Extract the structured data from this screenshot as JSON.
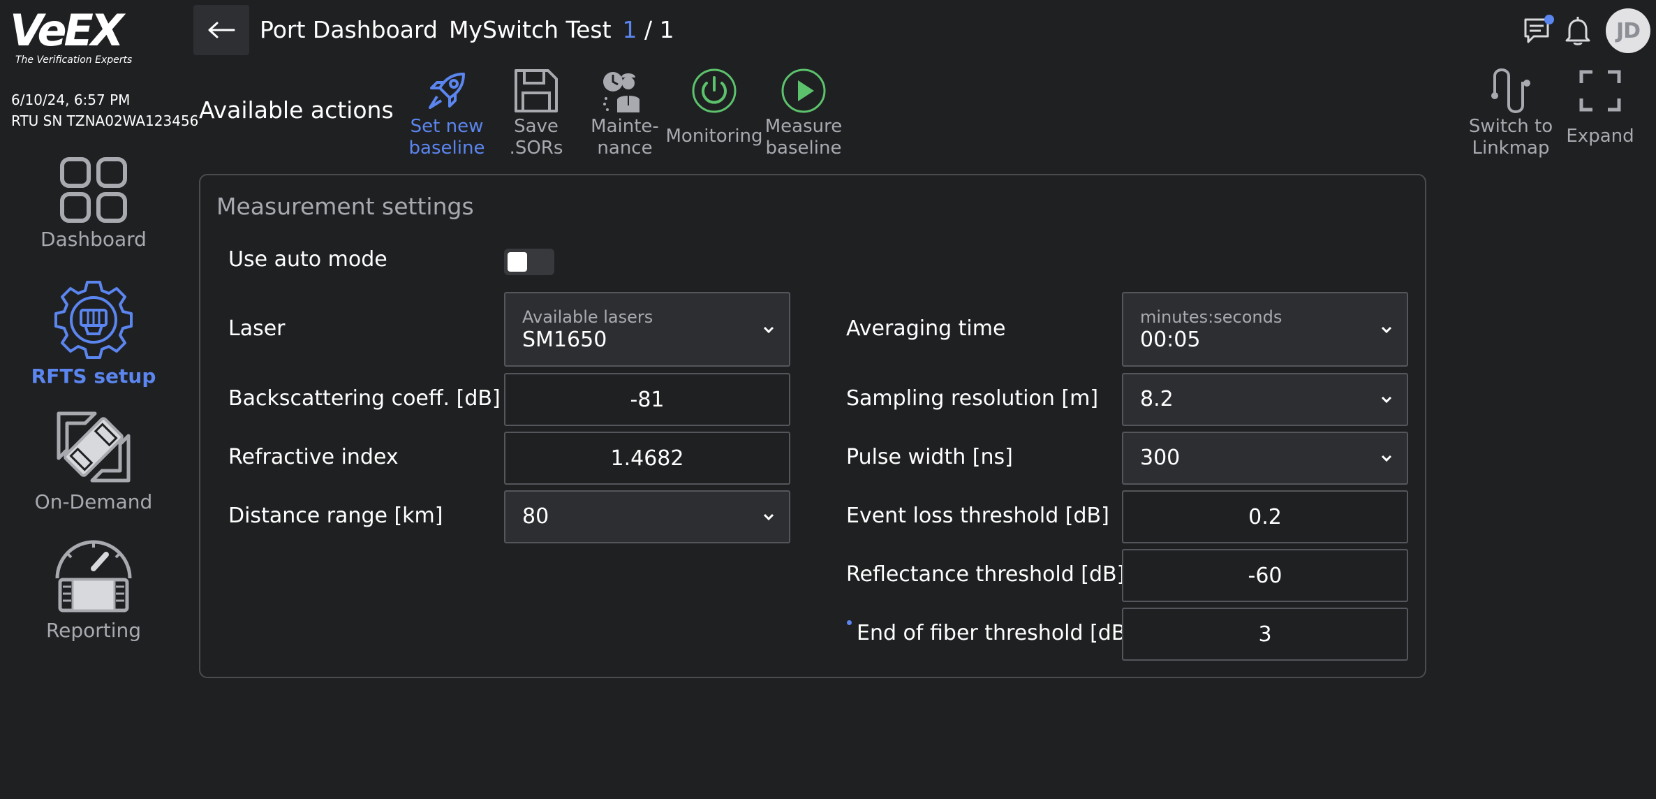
{
  "brand": {
    "logo_text": "VeEX",
    "tagline": "The Verification Experts"
  },
  "device": {
    "datetime": "6/10/24, 6:57 PM",
    "serial": "RTU SN TZNA02WA123456"
  },
  "header": {
    "title": "Port Dashboard",
    "subtitle": "MySwitch Test",
    "page_current": "1",
    "page_separator": "/ 1",
    "avatar_initials": "JD"
  },
  "sidebar": {
    "items": [
      {
        "label": "Dashboard",
        "icon": "grid-icon",
        "active": false
      },
      {
        "label": "RFTS setup",
        "icon": "gear-icon",
        "active": true
      },
      {
        "label": "On-Demand",
        "icon": "ondemand-icon",
        "active": false
      },
      {
        "label": "Reporting",
        "icon": "gauge-icon",
        "active": false
      }
    ]
  },
  "actions": {
    "title": "Available actions",
    "items": [
      {
        "line1": "Set new",
        "line2": "baseline",
        "icon": "rocket-icon",
        "active": true
      },
      {
        "line1": "Save",
        "line2": ".SORs",
        "icon": "save-icon",
        "active": false
      },
      {
        "line1": "Mainte-",
        "line2": "nance",
        "icon": "maintenance-icon",
        "active": false
      },
      {
        "line1": "Monitoring",
        "line2": "",
        "icon": "power-icon",
        "active": false
      },
      {
        "line1": "Measure",
        "line2": "baseline",
        "icon": "play-icon",
        "active": false
      }
    ],
    "switch_linkmap": {
      "line1": "Switch to",
      "line2": "Linkmap"
    },
    "expand": {
      "line1": "Expand"
    }
  },
  "settings": {
    "title": "Measurement settings",
    "auto_mode": {
      "label": "Use auto mode",
      "on": false
    },
    "laser": {
      "label": "Laser",
      "sub": "Available lasers",
      "value": "SM1650"
    },
    "backscatter": {
      "label": "Backscattering coeff. [dB]",
      "value": "-81"
    },
    "refractive": {
      "label": "Refractive index",
      "value": "1.4682"
    },
    "distance": {
      "label": "Distance range [km]",
      "value": "80"
    },
    "averaging": {
      "label": "Averaging time",
      "sub": "minutes:seconds",
      "value": "00:05"
    },
    "sampling": {
      "label": "Sampling resolution [m]",
      "value": "8.2"
    },
    "pulse": {
      "label": "Pulse width [ns]",
      "value": "300"
    },
    "event_loss": {
      "label": "Event loss threshold [dB]",
      "value": "0.2"
    },
    "reflectance": {
      "label": "Reflectance threshold [dB]",
      "value": "-60"
    },
    "end_fiber": {
      "label": "End of fiber threshold [dB]",
      "value": "3"
    }
  },
  "colors": {
    "background": "#1f2022",
    "accent": "#5b86f0",
    "green": "#5cc36c",
    "muted": "#a8aab0"
  }
}
